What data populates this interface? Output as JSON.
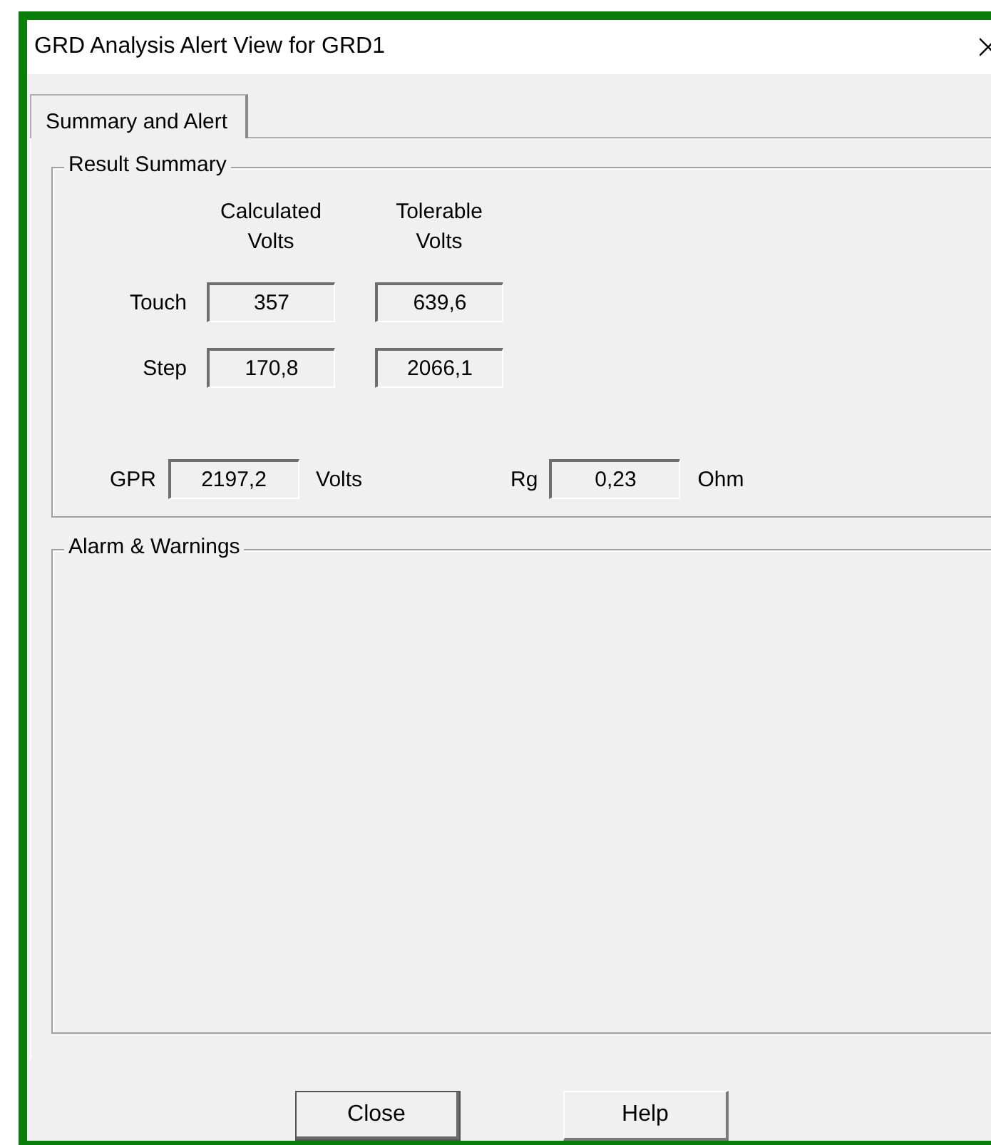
{
  "window": {
    "title": "GRD Analysis Alert View for GRD1"
  },
  "tabs": [
    {
      "label": "Summary and Alert",
      "selected": true
    }
  ],
  "result_summary": {
    "title": "Result Summary",
    "column_headers": [
      "Calculated Volts",
      "Tolerable Volts"
    ],
    "rows": [
      {
        "label": "Touch",
        "calculated": "357",
        "tolerable": "639,6"
      },
      {
        "label": "Step",
        "calculated": "170,8",
        "tolerable": "2066,1"
      }
    ],
    "gpr": {
      "label": "GPR",
      "value": "2197,2",
      "unit": "Volts"
    },
    "rg": {
      "label": "Rg",
      "value": "0,23",
      "unit": "Ohm"
    }
  },
  "alarms": {
    "title": "Alarm & Warnings"
  },
  "buttons": [
    {
      "label": "Close",
      "default": true
    },
    {
      "label": "Help",
      "default": false
    }
  ]
}
